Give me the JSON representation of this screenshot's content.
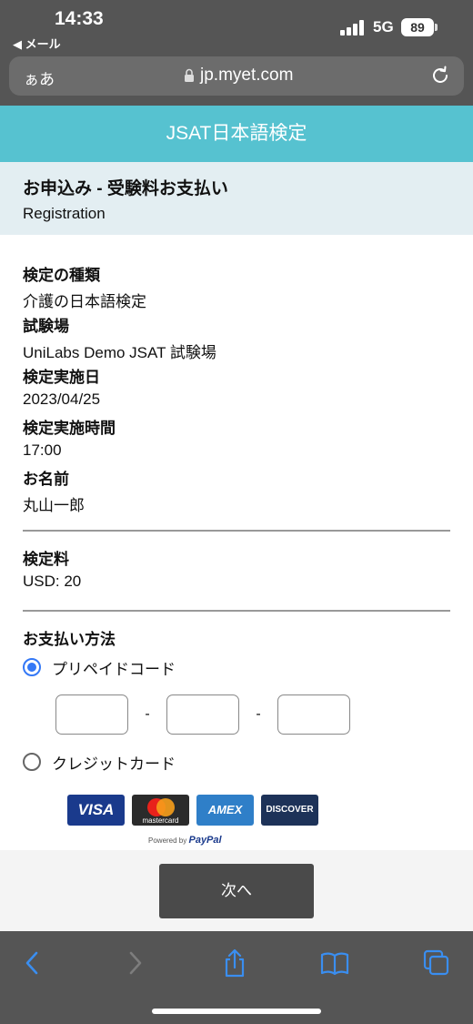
{
  "status_bar": {
    "time": "14:33",
    "back_app": "◀ メール",
    "network": "5G",
    "battery": "89"
  },
  "url_bar": {
    "text_size_label": "ぁあ",
    "url": "jp.myet.com"
  },
  "header": {
    "title": "JSAT日本語検定"
  },
  "section": {
    "title": "お申込み - 受験料お支払い",
    "subtitle": "Registration"
  },
  "details": [
    {
      "label": "検定の種類",
      "value": "介護の日本語検定"
    },
    {
      "label": "試験場",
      "value": "UniLabs Demo JSAT 試験場"
    },
    {
      "label": "検定実施日",
      "value": "2023/04/25"
    },
    {
      "label": "検定実施時間",
      "value": "17:00"
    },
    {
      "label": "お名前",
      "value": "丸山一郎"
    }
  ],
  "fee": {
    "label": "検定料",
    "value": "USD: 20"
  },
  "payment": {
    "label": "お支払い方法",
    "options": [
      {
        "label": "プリペイドコード",
        "selected": true
      },
      {
        "label": "クレジットカード",
        "selected": false
      }
    ],
    "code_separator": "-",
    "cards": {
      "visa": "VISA",
      "mastercard": "mastercard",
      "amex": "AMEX",
      "discover": "DISCOVER"
    },
    "powered_by": "Powered by",
    "paypal": "PayPal"
  },
  "next_button": "次へ",
  "colors": {
    "header_bg": "#56c2d0",
    "subheader_bg": "#e3eef2",
    "radio_selected": "#3478f6",
    "button_bg": "#4a4a4a",
    "toolbar_icon": "#3a8ef0"
  },
  "toolbar_icons": [
    "back-icon",
    "forward-icon",
    "share-icon",
    "bookmarks-icon",
    "tabs-icon"
  ]
}
